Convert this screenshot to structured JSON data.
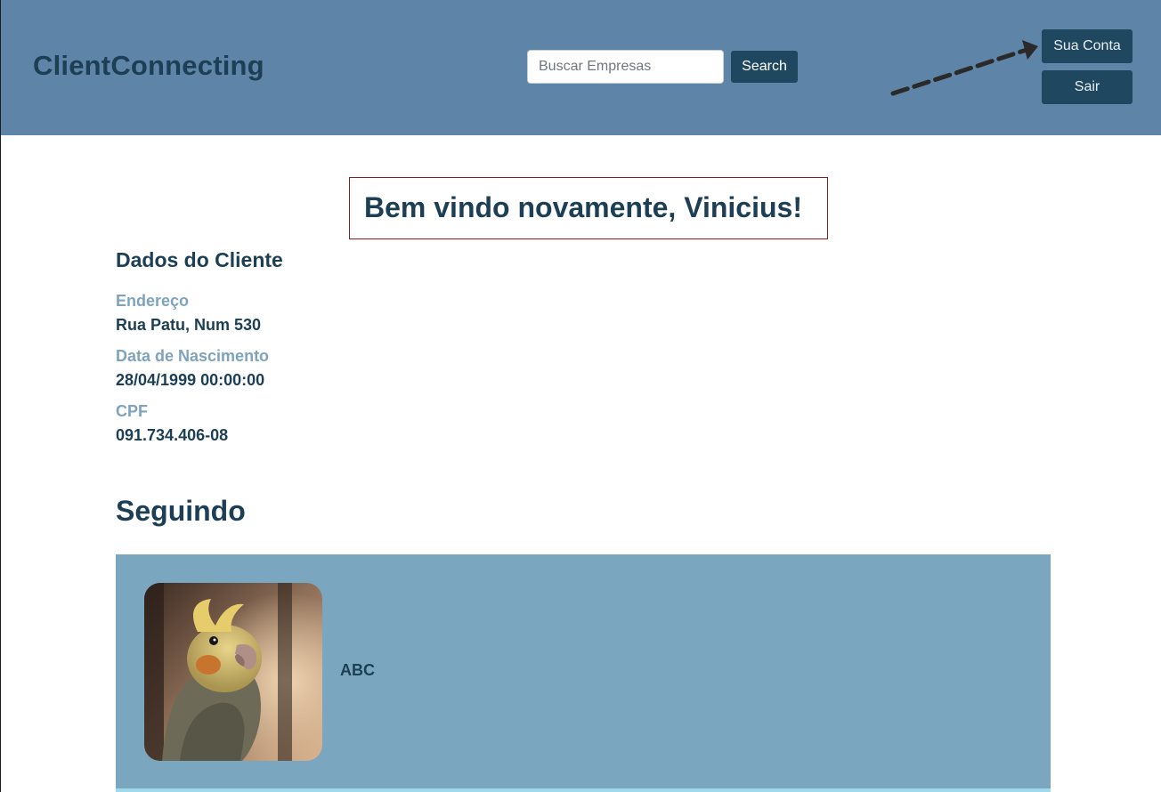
{
  "header": {
    "brand": "ClientConnecting",
    "search": {
      "placeholder": "Buscar Empresas",
      "value": "",
      "button_label": "Search"
    },
    "account_button": "Sua Conta",
    "logout_button": "Sair",
    "colors": {
      "background": "#5e84a7",
      "button": "#1f4860",
      "brand_text": "#1d3f56"
    }
  },
  "welcome": {
    "message": "Bem vindo novamente, Vinicius!",
    "border_color": "#8e1b1f"
  },
  "client": {
    "section_title": "Dados do Cliente",
    "fields": [
      {
        "label": "Endereço",
        "value": "Rua Patu, Num 530"
      },
      {
        "label": "Data de Nascimento",
        "value": "28/04/1999 00:00:00"
      },
      {
        "label": "CPF",
        "value": "091.734.406-08"
      }
    ]
  },
  "following": {
    "title": "Seguindo",
    "items": [
      {
        "name": "ABC",
        "image_icon": "cockatiel-photo"
      }
    ],
    "card_color": "#7ba6bf"
  }
}
